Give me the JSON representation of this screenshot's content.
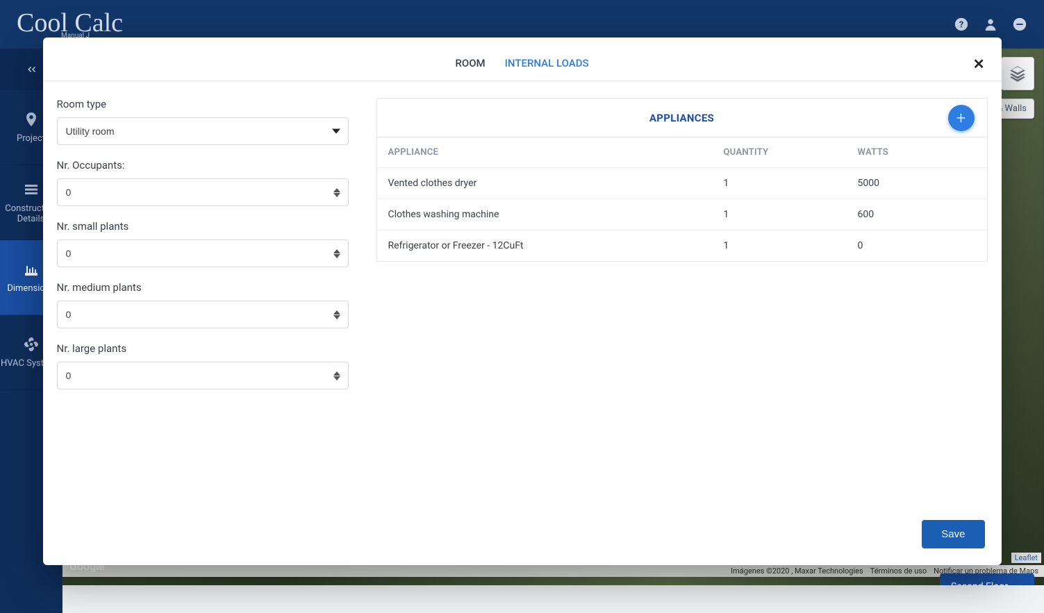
{
  "brand": {
    "name": "Cool Calc",
    "subtitle": "Manual J"
  },
  "sidebar": {
    "items": [
      {
        "label": "Project"
      },
      {
        "label": "Construction Details"
      },
      {
        "label": "Dimensions"
      },
      {
        "label": "HVAC Systems"
      }
    ]
  },
  "map": {
    "pill": "& Walls",
    "floor_button": "Second Floor",
    "google": "Google",
    "leaflet": "Leaflet",
    "attrib_1": "Imágenes ©2020 , Maxar Technologies",
    "attrib_2": "Términos de uso",
    "attrib_3": "Notificar un problema de Maps"
  },
  "modal": {
    "tabs": {
      "room": "ROOM",
      "internal": "INTERNAL LOADS"
    },
    "close": "✕",
    "save": "Save",
    "form": {
      "room_type_label": "Room type",
      "room_type_value": "Utility room",
      "occupants_label": "Nr. Occupants:",
      "occupants_value": "0",
      "small_plants_label": "Nr. small plants",
      "small_plants_value": "0",
      "medium_plants_label": "Nr. medium plants",
      "medium_plants_value": "0",
      "large_plants_label": "Nr. large plants",
      "large_plants_value": "0"
    },
    "appliances": {
      "title": "APPLIANCES",
      "headers": {
        "name": "APPLIANCE",
        "qty": "QUANTITY",
        "watts": "WATTS"
      },
      "rows": [
        {
          "name": "Vented clothes dryer",
          "qty": "1",
          "watts": "5000"
        },
        {
          "name": "Clothes washing machine",
          "qty": "1",
          "watts": "600"
        },
        {
          "name": "Refrigerator or Freezer - 12CuFt",
          "qty": "1",
          "watts": "0"
        }
      ]
    }
  }
}
